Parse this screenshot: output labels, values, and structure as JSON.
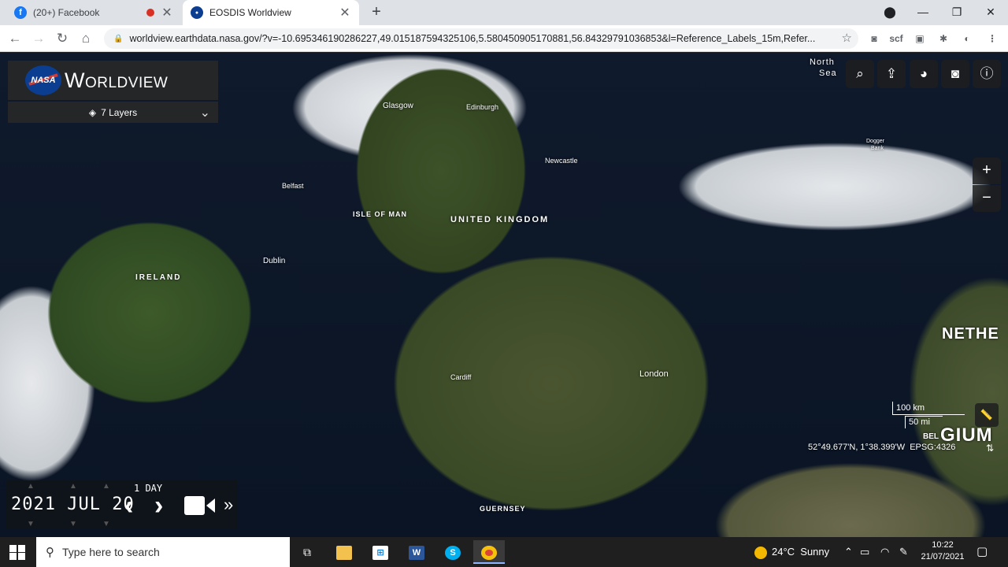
{
  "browser": {
    "tabs": [
      {
        "title": "(20+) Facebook",
        "favicon": "facebook-icon"
      },
      {
        "title": "EOSDIS Worldview",
        "favicon": "nasa-icon"
      }
    ],
    "url": "worldview.earthdata.nasa.gov/?v=-10.695346190286227,49.015187594325106,5.580450905170881,56.84329791036853&l=Reference_Labels_15m,Refer...",
    "extensions": [
      "scf"
    ]
  },
  "worldview": {
    "logo_text": "NASA",
    "title": "Worldview",
    "layers_label": "7 Layers"
  },
  "map": {
    "labels": {
      "uk": "UNITED KINGDOM",
      "ireland": "IRELAND",
      "isle_of_man": "ISLE OF MAN",
      "guernsey": "GUERNSEY",
      "netherlands": "NETHE",
      "belgium_a": "BEL",
      "belgium_b": "GIUM",
      "glasgow": "Glasgow",
      "edinburgh": "Edinburgh",
      "newcastle": "Newcastle",
      "belfast": "Belfast",
      "dublin": "Dublin",
      "cardiff": "Cardiff",
      "london": "London",
      "north_sea_a": "North",
      "north_sea_b": "Sea",
      "dogger_a": "Dogger",
      "dogger_b": "Bank"
    },
    "scale_km": "100 km",
    "scale_mi": "50 mi",
    "coordinates": "52°49.677'N, 1°38.399'W",
    "projection": "EPSG:4326"
  },
  "timeline": {
    "year": "2021",
    "month": "JUL",
    "day": "20",
    "interval": "1 DAY"
  },
  "taskbar": {
    "search_placeholder": "Type here to search",
    "weather_temp": "24°C",
    "weather_text": "Sunny",
    "time": "10:22",
    "date": "21/07/2021"
  }
}
